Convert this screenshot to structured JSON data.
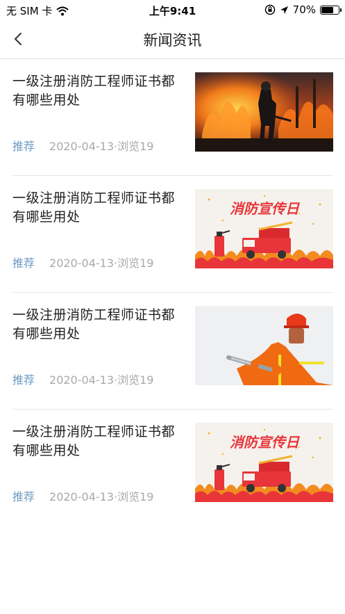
{
  "status_bar": {
    "carrier": "无 SIM 卡",
    "time": "上午9:41",
    "battery_percent": "70%",
    "battery_level": 0.7,
    "icons": [
      "wifi-icon",
      "orientation-lock-icon",
      "location-arrow-icon",
      "battery-icon"
    ]
  },
  "nav": {
    "title": "新闻资讯",
    "back_icon": "chevron-left-icon"
  },
  "news": [
    {
      "title": "一级注册消防工程师证书都有哪些用处",
      "tag": "推荐",
      "meta": "2020-04-13·浏览19",
      "image": "firefighter-flames-photo"
    },
    {
      "title": "一级注册消防工程师证书都有哪些用处",
      "tag": "推荐",
      "meta": "2020-04-13·浏览19",
      "image": "fire-safety-day-banner",
      "image_text": "消防宣传日"
    },
    {
      "title": "一级注册消防工程师证书都有哪些用处",
      "tag": "推荐",
      "meta": "2020-04-13·浏览19",
      "image": "firefighter-hose-photo"
    },
    {
      "title": "一级注册消防工程师证书都有哪些用处",
      "tag": "推荐",
      "meta": "2020-04-13·浏览19",
      "image": "fire-safety-day-banner",
      "image_text": "消防宣传日"
    }
  ],
  "colors": {
    "tag": "#6e9cc4",
    "meta": "#a9a9a9",
    "title": "#222222",
    "divider": "#e6e6e6",
    "banner_red": "#e8353a"
  }
}
